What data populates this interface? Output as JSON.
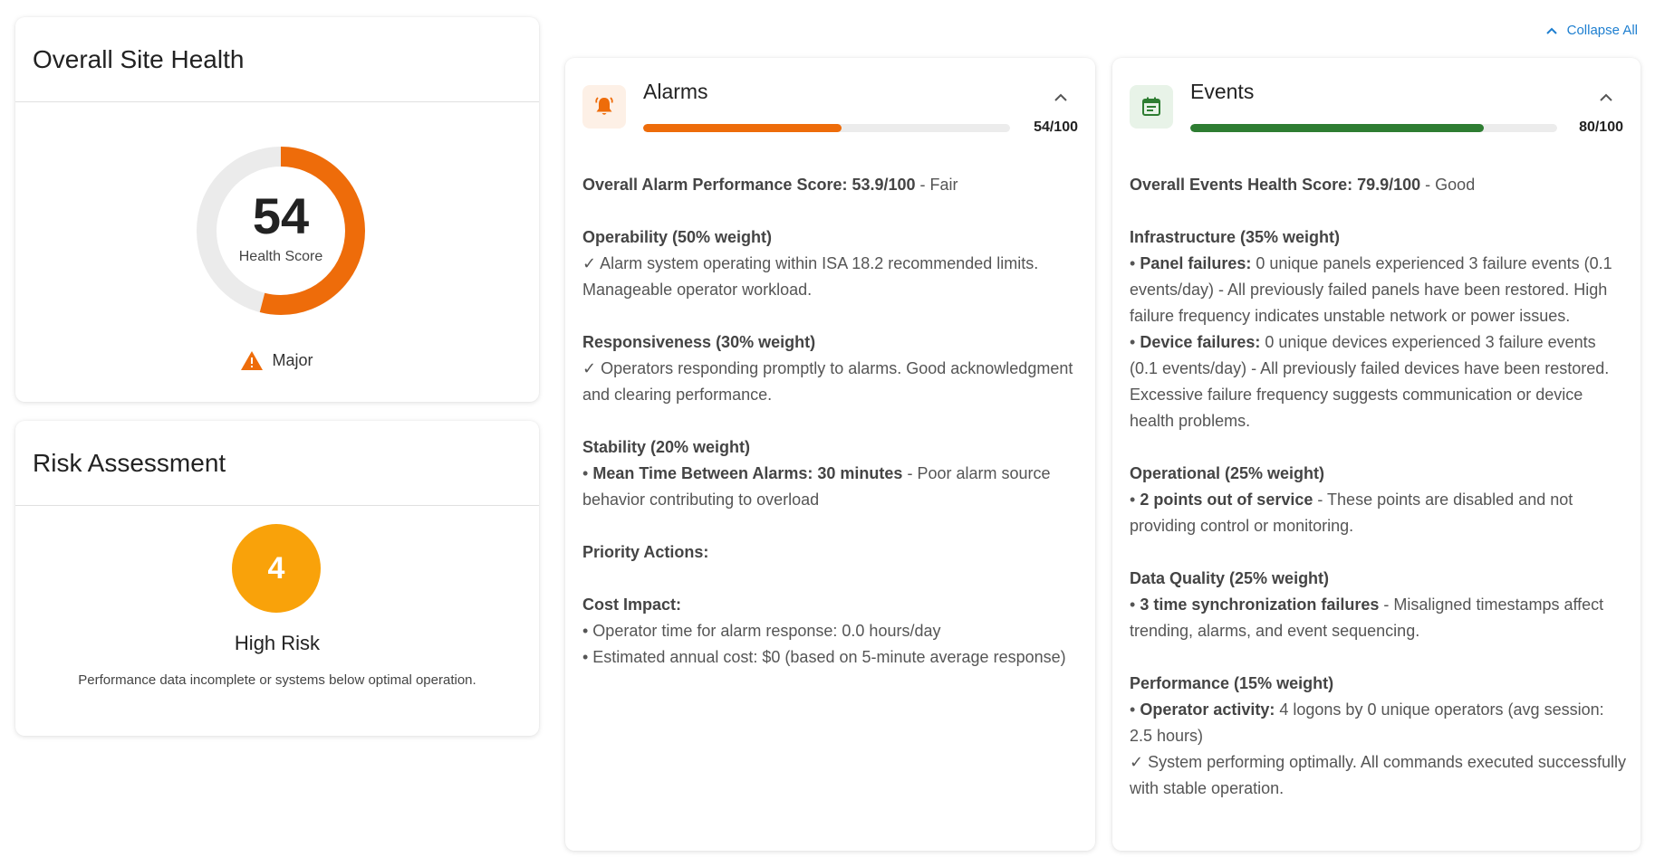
{
  "colors": {
    "alarm_accent": "#ee6c0a",
    "event_accent": "#2e7d32",
    "risk_badge": "#f9a20a",
    "link": "#1e7fd0"
  },
  "health": {
    "title": "Overall Site Health",
    "score": "54",
    "score_fraction": 0.54,
    "score_label": "Health Score",
    "severity_icon": "warning-triangle-icon",
    "severity": "Major"
  },
  "risk": {
    "title": "Risk Assessment",
    "value": "4",
    "level": "High Risk",
    "description": "Performance data incomplete or systems below optimal operation."
  },
  "collapse_all": {
    "icon": "chevron-up-icon",
    "label": "Collapse All"
  },
  "alarms": {
    "icon": "bell-icon",
    "title": "Alarms",
    "score_text": "54/100",
    "score_fraction": 0.54,
    "summary": {
      "label": "Overall Alarm Performance Score: 53.9/100",
      "rest": " - Fair"
    },
    "operability": {
      "heading": "Operability (50% weight)",
      "text": "✓ Alarm system operating within ISA 18.2 recommended limits. Manageable operator workload."
    },
    "responsiveness": {
      "heading": "Responsiveness (30% weight)",
      "text": "✓ Operators responding promptly to alarms. Good acknowledgment and clearing performance."
    },
    "stability": {
      "heading": "Stability (20% weight)",
      "bullet": "•",
      "item_bold": "Mean Time Between Alarms: 30 minutes",
      "item_rest": " - Poor alarm source behavior contributing to overload"
    },
    "priority": {
      "heading": "Priority Actions:"
    },
    "cost": {
      "heading": "Cost Impact:",
      "line1": "• Operator time for alarm response: 0.0 hours/day",
      "line2": "• Estimated annual cost: $0 (based on 5-minute average response)"
    }
  },
  "events": {
    "icon": "calendar-icon",
    "title": "Events",
    "score_text": "80/100",
    "score_fraction": 0.8,
    "summary": {
      "label": "Overall Events Health Score: 79.9/100",
      "rest": " - Good"
    },
    "infrastructure": {
      "heading": "Infrastructure (35% weight)",
      "bullet": "•",
      "panel_bold": "Panel failures:",
      "panel_rest": " 0 unique panels experienced 3 failure events (0.1 events/day) - All previously failed panels have been restored. High failure frequency indicates unstable network or power issues.",
      "device_bold": "Device failures:",
      "device_rest": " 0 unique devices experienced 3 failure events (0.1 events/day) - All previously failed devices have been restored. Excessive failure frequency suggests communication or device health problems."
    },
    "operational": {
      "heading": "Operational (25% weight)",
      "bullet": "•",
      "item_bold": "2 points out of service",
      "item_rest": " - These points are disabled and not providing control or monitoring."
    },
    "data_quality": {
      "heading": "Data Quality (25% weight)",
      "bullet": "•",
      "item_bold": "3 time synchronization failures",
      "item_rest": " - Misaligned timestamps affect trending, alarms, and event sequencing."
    },
    "performance": {
      "heading": "Performance (15% weight)",
      "bullet": "•",
      "item_bold": "Operator activity:",
      "item_rest": " 4 logons by 0 unique operators (avg session: 2.5 hours)",
      "check_text": "✓ System performing optimally. All commands executed successfully with stable operation."
    }
  }
}
